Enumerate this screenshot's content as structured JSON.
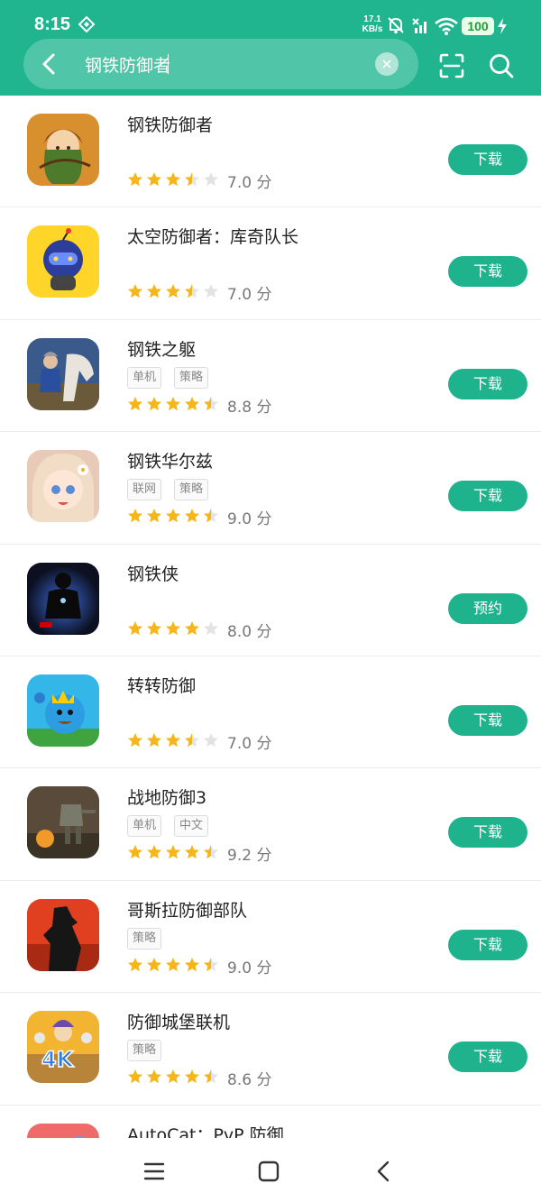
{
  "status_bar": {
    "time": "8:15",
    "speed_value": "17.1",
    "speed_unit": "KB/s",
    "battery": "100"
  },
  "search": {
    "query": "钢铁防御者",
    "clear_glyph": "×"
  },
  "colors": {
    "brand": "#20b58f",
    "button": "#1fb38d",
    "star": "#f6b619",
    "star_empty": "#e3e3e3"
  },
  "results": [
    {
      "name": "钢铁防御者",
      "tags": [],
      "rating": 3.5,
      "score": "7.0 分",
      "button": "下载",
      "icon": "archer-girl-icon",
      "icon_bg": "#d8902e"
    },
    {
      "name": "太空防御者：库奇队长",
      "tags": [],
      "rating": 3.5,
      "score": "7.0 分",
      "button": "下载",
      "icon": "space-robot-icon",
      "icon_bg": "#ffd52a"
    },
    {
      "name": "钢铁之躯",
      "tags": [
        "单机",
        "策略"
      ],
      "rating": 4.5,
      "score": "8.8 分",
      "button": "下载",
      "icon": "knight-horse-icon",
      "icon_bg": "#3a5a8c"
    },
    {
      "name": "钢铁华尔兹",
      "tags": [
        "联网",
        "策略"
      ],
      "rating": 4.5,
      "score": "9.0 分",
      "button": "下载",
      "icon": "anime-girl-icon",
      "icon_bg": "#e9c9b8"
    },
    {
      "name": "钢铁侠",
      "tags": [],
      "rating": 4,
      "score": "8.0 分",
      "button": "预约",
      "icon": "iron-man-icon",
      "icon_bg": "#141a2b"
    },
    {
      "name": "转转防御",
      "tags": [],
      "rating": 3.5,
      "score": "7.0 分",
      "button": "下载",
      "icon": "blue-king-icon",
      "icon_bg": "#35b6e8"
    },
    {
      "name": "战地防御3",
      "tags": [
        "单机",
        "中文"
      ],
      "rating": 4.5,
      "score": "9.2 分",
      "button": "下载",
      "icon": "battle-mech-icon",
      "icon_bg": "#5a4a3a"
    },
    {
      "name": "哥斯拉防御部队",
      "tags": [
        "策略"
      ],
      "rating": 4.5,
      "score": "9.0 分",
      "button": "下载",
      "icon": "godzilla-icon",
      "icon_bg": "#e0401f"
    },
    {
      "name": "防御城堡联机",
      "tags": [
        "策略"
      ],
      "rating": 4.5,
      "score": "8.6 分",
      "button": "下载",
      "icon": "castle-heroes-icon",
      "icon_bg": "#f2b431"
    },
    {
      "name": "AutoCat：PvP 防御",
      "tags": [],
      "rating": 0,
      "score": "",
      "button": "",
      "icon": "autocat-icon",
      "icon_bg": "#f06a6a"
    }
  ],
  "navigation": {
    "menu_icon": "menu-icon",
    "home_icon": "home-square-icon",
    "back_icon": "back-chevron-icon"
  }
}
